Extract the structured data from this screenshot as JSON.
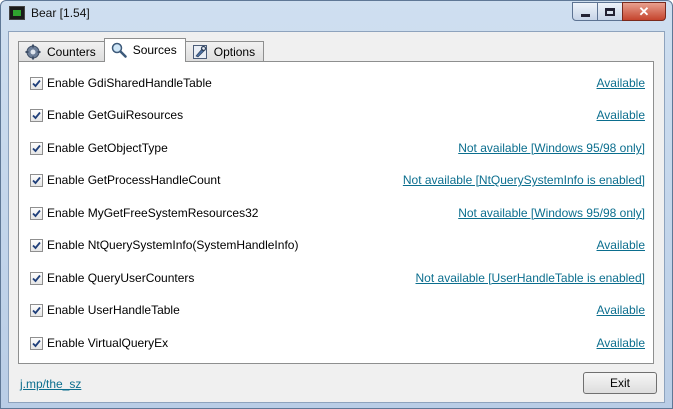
{
  "window": {
    "title": "Bear [1.54]"
  },
  "titlebar": {
    "minimize": "minimize-icon",
    "maximize": "maximize-icon",
    "close_label": "✕"
  },
  "tabs": [
    {
      "label": "Counters",
      "icon": "gear-icon",
      "active": false
    },
    {
      "label": "Sources",
      "icon": "magnifier-icon",
      "active": true
    },
    {
      "label": "Options",
      "icon": "options-icon",
      "active": false
    }
  ],
  "sources": [
    {
      "label": "Enable GdiSharedHandleTable",
      "checked": true,
      "status": "Available"
    },
    {
      "label": "Enable GetGuiResources",
      "checked": true,
      "status": "Available"
    },
    {
      "label": "Enable GetObjectType",
      "checked": true,
      "status": "Not available [Windows 95/98 only]"
    },
    {
      "label": "Enable GetProcessHandleCount",
      "checked": true,
      "status": "Not available [NtQuerySystemInfo is enabled]"
    },
    {
      "label": "Enable MyGetFreeSystemResources32",
      "checked": true,
      "status": "Not available [Windows 95/98 only]"
    },
    {
      "label": "Enable NtQuerySystemInfo(SystemHandleInfo)",
      "checked": true,
      "status": "Available"
    },
    {
      "label": "Enable QueryUserCounters",
      "checked": true,
      "status": "Not available [UserHandleTable is enabled]"
    },
    {
      "label": "Enable UserHandleTable",
      "checked": true,
      "status": "Available"
    },
    {
      "label": "Enable VirtualQueryEx",
      "checked": true,
      "status": "Available"
    }
  ],
  "footer": {
    "link": "j.mp/the_sz",
    "exit_label": "Exit"
  },
  "colors": {
    "link": "#0b6e8e",
    "titlebar": "#b9cde6",
    "close": "#c5442d"
  }
}
